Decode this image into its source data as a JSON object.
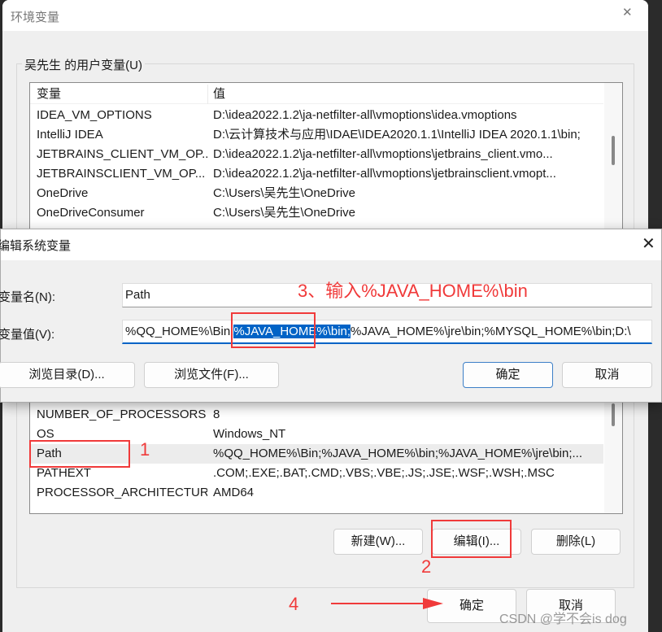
{
  "window": {
    "title": "环境变量",
    "group_label": "吴先生 的用户变量(U)",
    "columns": [
      "变量",
      "值"
    ],
    "user_rows": [
      {
        "name": "IDEA_VM_OPTIONS",
        "value": "D:\\idea2022.1.2\\ja-netfilter-all\\vmoptions\\idea.vmoptions"
      },
      {
        "name": "IntelliJ IDEA",
        "value": "D:\\云计算技术与应用\\IDAE\\IDEA2020.1.1\\IntelliJ IDEA 2020.1.1\\bin;"
      },
      {
        "name": "JETBRAINS_CLIENT_VM_OP...",
        "value": "D:\\idea2022.1.2\\ja-netfilter-all\\vmoptions\\jetbrains_client.vmo..."
      },
      {
        "name": "JETBRAINSCLIENT_VM_OP...",
        "value": "D:\\idea2022.1.2\\ja-netfilter-all\\vmoptions\\jetbrainsclient.vmopt..."
      },
      {
        "name": "OneDrive",
        "value": "C:\\Users\\吴先生\\OneDrive"
      },
      {
        "name": "OneDriveConsumer",
        "value": "C:\\Users\\吴先生\\OneDrive"
      },
      {
        "name": "",
        "value": ""
      }
    ],
    "system_rows": [
      {
        "name": "",
        "value": ""
      },
      {
        "name": "NUMBER_OF_PROCESSORS",
        "value": "8"
      },
      {
        "name": "OS",
        "value": "Windows_NT"
      },
      {
        "name": "Path",
        "value": "%QQ_HOME%\\Bin;%JAVA_HOME%\\bin;%JAVA_HOME%\\jre\\bin;..."
      },
      {
        "name": "PATHEXT",
        "value": ".COM;.EXE;.BAT;.CMD;.VBS;.VBE;.JS;.JSE;.WSF;.WSH;.MSC"
      },
      {
        "name": "PROCESSOR_ARCHITECTURE",
        "value": "AMD64"
      },
      {
        "name": "",
        "value": ""
      }
    ],
    "selected_system_row": "Path",
    "buttons": {
      "new": "新建(W)...",
      "edit": "编辑(I)...",
      "delete": "删除(L)",
      "ok": "确定",
      "cancel": "取消"
    }
  },
  "dialog": {
    "title": "编辑系统变量",
    "name_label": "变量名(N):",
    "name_value": "Path",
    "value_label": "变量值(V):",
    "value_before": "%QQ_HOME%\\Bin;",
    "value_selected": "%JAVA_HOME%\\bin;",
    "value_after": "%JAVA_HOME%\\jre\\bin;%MYSQL_HOME%\\bin;D:\\",
    "buttons": {
      "browse_dir": "浏览目录(D)...",
      "browse_file": "浏览文件(F)...",
      "ok": "确定",
      "cancel": "取消"
    }
  },
  "annotations": {
    "step1": "1",
    "step2": "2",
    "step3": "3、输入%JAVA_HOME%\\bin",
    "step4": "4",
    "color": "#f03a3a"
  },
  "watermark": "CSDN @学不会is dog"
}
